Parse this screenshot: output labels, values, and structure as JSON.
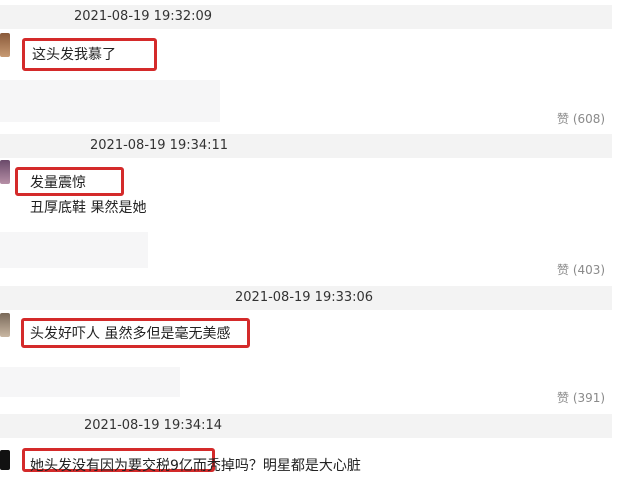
{
  "comments": [
    {
      "timestamp": "2021-08-19 19:32:09",
      "highlighted_text": "这头发我慕了",
      "extra_text": "",
      "like_label": "赞",
      "like_count": "(608)"
    },
    {
      "timestamp": "2021-08-19 19:34:11",
      "highlighted_text": "发量震惊",
      "extra_text": "丑厚底鞋 果然是她",
      "like_label": "赞",
      "like_count": "(403)"
    },
    {
      "timestamp": "2021-08-19 19:33:06",
      "highlighted_text": "头发好吓人 虽然多但是毫无美感",
      "extra_text": "",
      "like_label": "赞",
      "like_count": "(391)"
    },
    {
      "timestamp": "2021-08-19 19:34:14",
      "highlighted_text": "她头发",
      "extra_text": "没有因为要交税9亿而秃掉吗？明星都是大心脏",
      "like_label": "",
      "like_count": ""
    }
  ]
}
